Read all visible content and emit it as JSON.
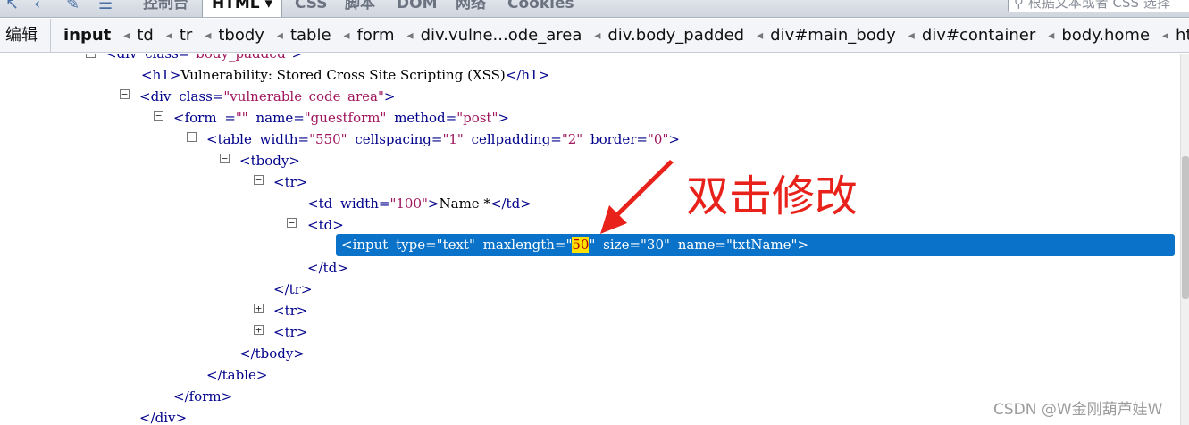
{
  "tabs": {
    "console": "控制台",
    "html": "HTML ▾",
    "css": "CSS",
    "script": "脚本",
    "dom": "DOM",
    "net": "网络",
    "cookies": "Cookies"
  },
  "search": {
    "text": "根据文本或者 CSS 选择"
  },
  "breadcrumb": {
    "edit": "编辑",
    "items": [
      "input",
      "td",
      "tr",
      "tbody",
      "table",
      "form",
      "div.vulne...ode_area",
      "div.body_padded",
      "div#main_body",
      "div#container",
      "body.home",
      "html"
    ]
  },
  "tree": {
    "top_partial": {
      "tag": "<div",
      "attr": "class=",
      "val": "\"body_padded\"",
      "close": ">"
    },
    "h1_open": "<h1>",
    "h1_text": "Vulnerability: Stored Cross Site Scripting (XSS)",
    "h1_close": "</h1>",
    "div_open": "<div",
    "div_attr": "class=",
    "div_val": "\"vulnerable_code_area\"",
    "gt": ">",
    "form_open": "<form",
    "form_a1": "=",
    "form_v1": "\"\"",
    "form_a2": "name=",
    "form_v2": "\"guestform\"",
    "form_a3": "method=",
    "form_v3": "\"post\"",
    "table_open": "<table",
    "table_a1": "width=",
    "table_v1": "\"550\"",
    "table_a2": "cellspacing=",
    "table_v2": "\"1\"",
    "table_a3": "cellpadding=",
    "table_v3": "\"2\"",
    "table_a4": "border=",
    "table_v4": "\"0\"",
    "tbody_open": "<tbody>",
    "tr_open": "<tr>",
    "td_open": "<td",
    "td_a1": "width=",
    "td_v1": "\"100\"",
    "td_text": "Name *",
    "td_close": "</td>",
    "td_open2": "<td>",
    "input_open": "<input",
    "input_a1": "type=",
    "input_v1": "\"text\"",
    "input_a2": "maxlength=",
    "input_q1": "\"",
    "input_v2": "50",
    "input_q2": "\"",
    "input_a3": "size=",
    "input_v3": "\"30\"",
    "input_a4": "name=",
    "input_v4": "\"txtName\"",
    "tr_close": "</tr>",
    "tbody_close": "</tbody>",
    "table_close": "</table>",
    "form_close": "</form>",
    "div_close": "</div>",
    "plus": "+",
    "minus": "−"
  },
  "annotation": {
    "text": "双击修改",
    "color": "#e8221b"
  },
  "watermark": "CSDN @W金刚葫芦娃W",
  "colors": {
    "selection": "#0a72c8",
    "highlight": "#ffe100",
    "tag": "#00008b",
    "attr_value": "#a0165d"
  }
}
